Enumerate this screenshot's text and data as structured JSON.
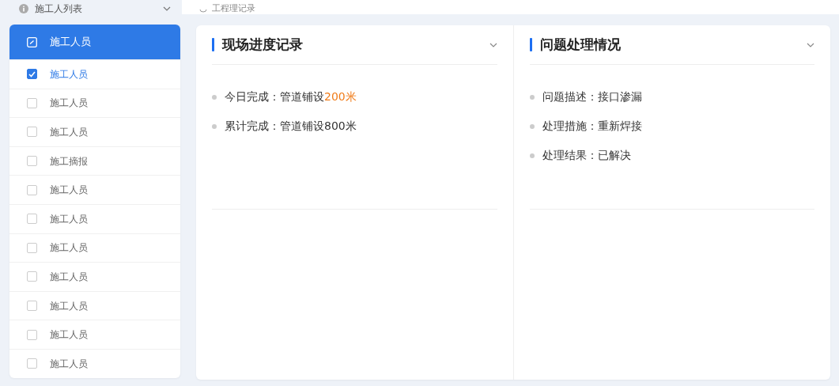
{
  "sidebar": {
    "title": "施工人列表",
    "items": [
      {
        "label": "施工人员",
        "selected": true,
        "checked": false
      },
      {
        "label": "施工人员",
        "selected": false,
        "checked": true
      },
      {
        "label": "施工人员",
        "selected": false,
        "checked": false
      },
      {
        "label": "施工人员",
        "selected": false,
        "checked": false
      },
      {
        "label": "施工摘报",
        "selected": false,
        "checked": false
      },
      {
        "label": "施工人员",
        "selected": false,
        "checked": false
      },
      {
        "label": "施工人员",
        "selected": false,
        "checked": false
      },
      {
        "label": "施工人员",
        "selected": false,
        "checked": false
      },
      {
        "label": "施工人员",
        "selected": false,
        "checked": false
      },
      {
        "label": "施工人员",
        "selected": false,
        "checked": false
      },
      {
        "label": "施工人员",
        "selected": false,
        "checked": false
      },
      {
        "label": "施工人员",
        "selected": false,
        "checked": false
      }
    ]
  },
  "top_bar": {
    "title": "工程理记录"
  },
  "panels": [
    {
      "title": "现场进度记录",
      "lines": [
        [
          {
            "text": "今日完成：管道铺设",
            "highlight": false
          },
          {
            "text": "200米",
            "highlight": true
          }
        ],
        [
          {
            "text": "累计完成：管道铺设800米",
            "highlight": false
          }
        ]
      ]
    },
    {
      "title": "问题处理情况",
      "lines": [
        [
          {
            "text": "问题描述：接口渗漏",
            "highlight": false
          }
        ],
        [
          {
            "text": "处理措施：重新焊接",
            "highlight": false
          }
        ],
        [
          {
            "text": "处理结果：已解决",
            "highlight": false
          }
        ]
      ]
    }
  ]
}
